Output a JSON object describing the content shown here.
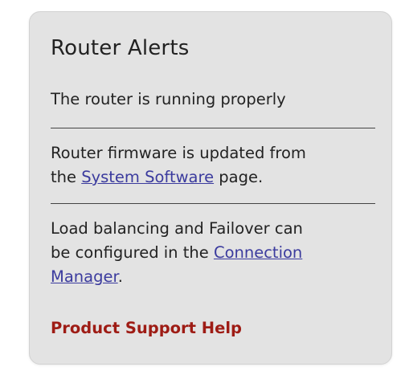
{
  "panel": {
    "title": "Router Alerts",
    "status_text": "The router is running properly",
    "firmware": {
      "line1": "Router firmware is updated from",
      "before_link": "the ",
      "link_text": "System Software",
      "after_link": " page."
    },
    "balancing": {
      "line1": "Load balancing and Failover can",
      "line2_before_link": "be configured in the ",
      "link_text_line2": "Connection",
      "link_text_line3": "Manager",
      "after_link": "."
    },
    "support_link": "Product Support Help"
  },
  "colors": {
    "panel_background": "#e3e3e3",
    "text": "#222222",
    "link": "#3b3b9e",
    "support_link": "#9e1c15"
  }
}
